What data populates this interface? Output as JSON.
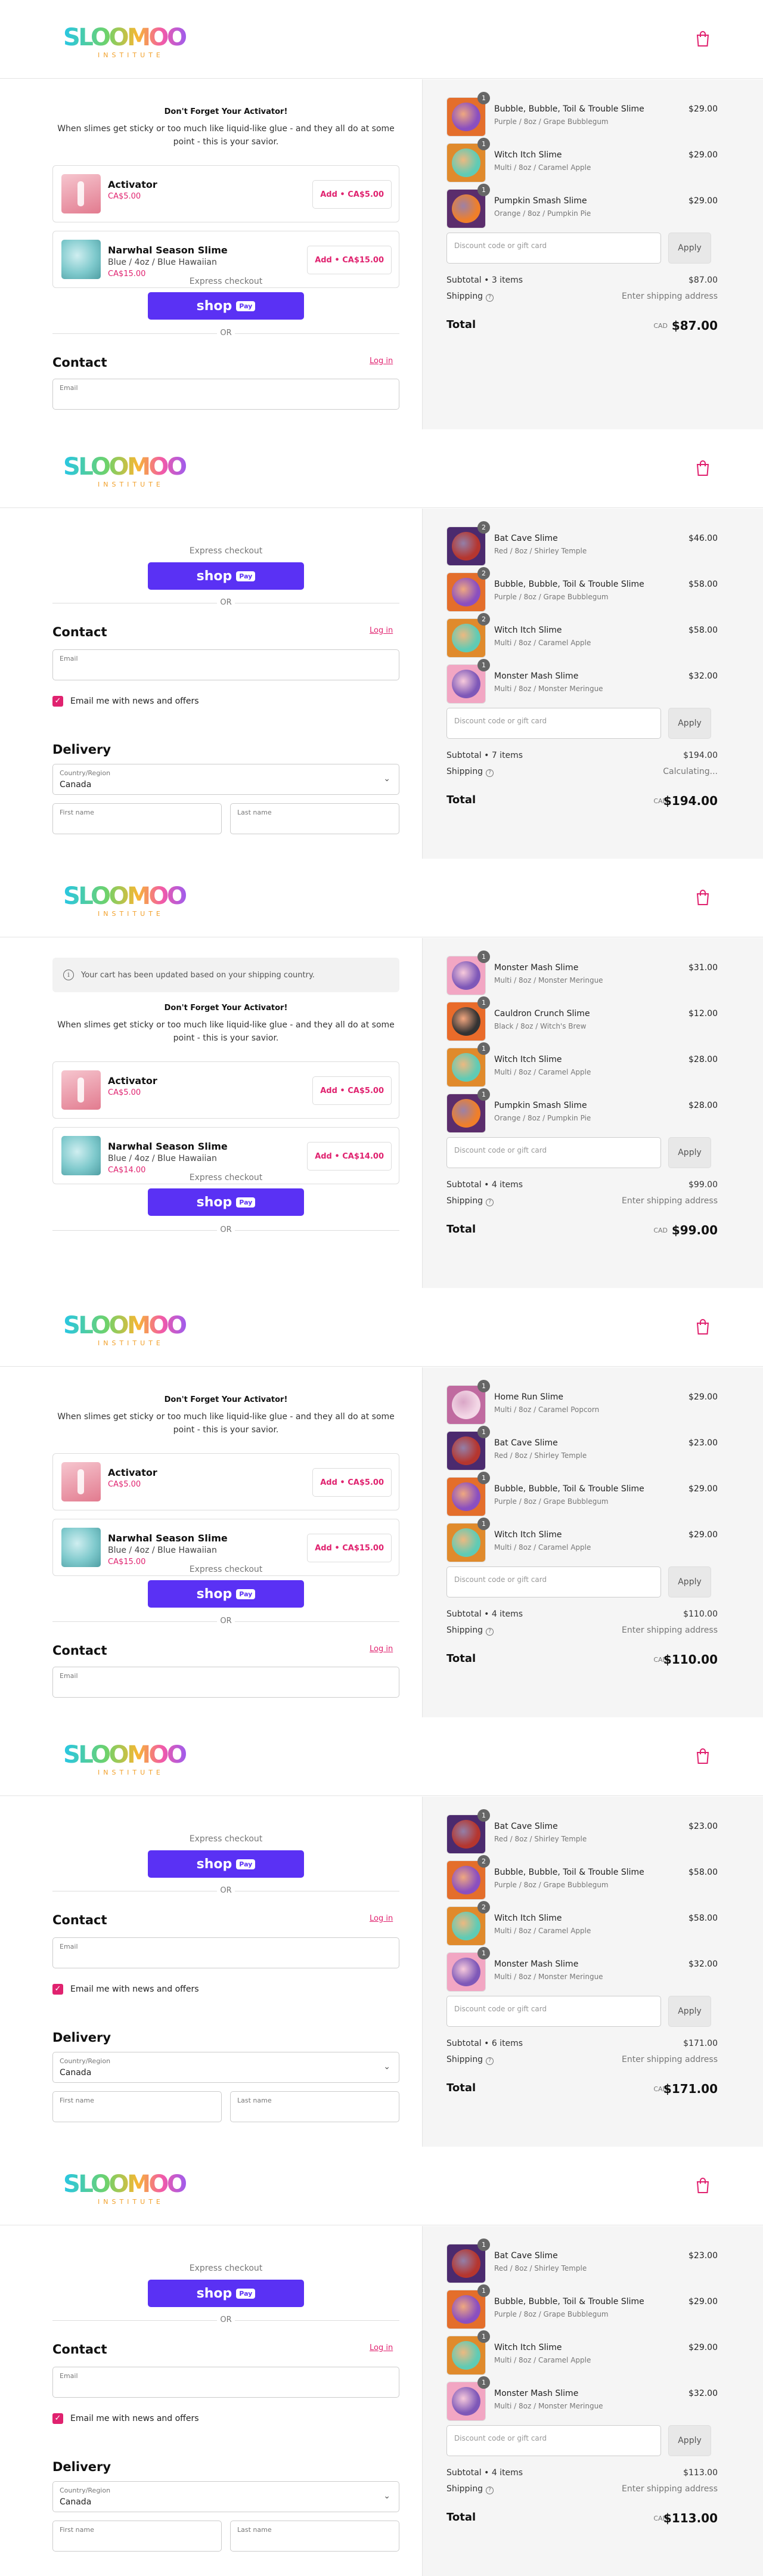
{
  "brand": {
    "name": "SLOOMOO",
    "sub": "INSTITUTE"
  },
  "common": {
    "upsell_title": "Don't Forget Your Activator!",
    "upsell_desc": "When slimes get sticky or too much like liquid-like glue - and they all do at some point - this is your savior.",
    "express_checkout": "Express checkout",
    "shop_label": "shop",
    "pay_label": "Pay",
    "or": "OR",
    "contact": "Contact",
    "login": "Log in",
    "email_label": "Email",
    "news_label": "Email me with news and offers",
    "delivery": "Delivery",
    "country_label": "Country/Region",
    "country_value": "Canada",
    "first_name": "First name",
    "last_name": "Last name",
    "discount_placeholder": "Discount code or gift card",
    "apply": "Apply",
    "shipping": "Shipping",
    "enter_shipping": "Enter shipping address",
    "calculating": "Calculating...",
    "total": "Total",
    "currency": "CAD",
    "cart_updated": "Your cart has been updated based on your shipping country."
  },
  "panels": [
    {
      "upsell": [
        {
          "name": "Activator",
          "variant": "",
          "price": "CA$5.00",
          "button": "Add • CA$5.00"
        },
        {
          "name": "Narwhal Season Slime",
          "variant": "Blue / 4oz / Blue Hawaiian",
          "price": "CA$15.00",
          "button": "Add • CA$15.00"
        }
      ],
      "items": [
        {
          "qty": "1",
          "name": "Bubble, Bubble, Toil & Trouble Slime",
          "variant": "Purple / 8oz / Grape Bubblegum",
          "price": "$29.00"
        },
        {
          "qty": "1",
          "name": "Witch Itch Slime",
          "variant": "Multi / 8oz / Caramel Apple",
          "price": "$29.00"
        },
        {
          "qty": "1",
          "name": "Pumpkin Smash Slime",
          "variant": "Orange / 8oz / Pumpkin Pie",
          "price": "$29.00"
        }
      ],
      "subtotal_label": "Subtotal • 3 items",
      "subtotal": "$87.00",
      "shipping_value": "Enter shipping address",
      "total": "$87.00"
    },
    {
      "items": [
        {
          "qty": "2",
          "name": "Bat Cave Slime",
          "variant": "Red / 8oz / Shirley Temple",
          "price": "$46.00"
        },
        {
          "qty": "2",
          "name": "Bubble, Bubble, Toil & Trouble Slime",
          "variant": "Purple / 8oz / Grape Bubblegum",
          "price": "$58.00"
        },
        {
          "qty": "2",
          "name": "Witch Itch Slime",
          "variant": "Multi / 8oz / Caramel Apple",
          "price": "$58.00"
        },
        {
          "qty": "1",
          "name": "Monster Mash Slime",
          "variant": "Multi / 8oz / Monster Meringue",
          "price": "$32.00"
        }
      ],
      "subtotal_label": "Subtotal • 7 items",
      "subtotal": "$194.00",
      "shipping_value": "Calculating...",
      "total": "$194.00"
    },
    {
      "upsell": [
        {
          "name": "Activator",
          "variant": "",
          "price": "CA$5.00",
          "button": "Add • CA$5.00"
        },
        {
          "name": "Narwhal Season Slime",
          "variant": "Blue / 4oz / Blue Hawaiian",
          "price": "CA$14.00",
          "button": "Add • CA$14.00"
        }
      ],
      "items": [
        {
          "qty": "1",
          "name": "Monster Mash Slime",
          "variant": "Multi / 8oz / Monster Meringue",
          "price": "$31.00"
        },
        {
          "qty": "1",
          "name": "Cauldron Crunch Slime",
          "variant": "Black / 8oz / Witch's Brew",
          "price": "$12.00"
        },
        {
          "qty": "1",
          "name": "Witch Itch Slime",
          "variant": "Multi / 8oz / Caramel Apple",
          "price": "$28.00"
        },
        {
          "qty": "1",
          "name": "Pumpkin Smash Slime",
          "variant": "Orange / 8oz / Pumpkin Pie",
          "price": "$28.00"
        }
      ],
      "subtotal_label": "Subtotal • 4 items",
      "subtotal": "$99.00",
      "shipping_value": "Enter shipping address",
      "total": "$99.00"
    },
    {
      "upsell": [
        {
          "name": "Activator",
          "variant": "",
          "price": "CA$5.00",
          "button": "Add • CA$5.00"
        },
        {
          "name": "Narwhal Season Slime",
          "variant": "Blue / 4oz / Blue Hawaiian",
          "price": "CA$15.00",
          "button": "Add • CA$15.00"
        }
      ],
      "items": [
        {
          "qty": "1",
          "name": "Home Run Slime",
          "variant": "Multi / 8oz / Caramel Popcorn",
          "price": "$29.00"
        },
        {
          "qty": "1",
          "name": "Bat Cave Slime",
          "variant": "Red / 8oz / Shirley Temple",
          "price": "$23.00"
        },
        {
          "qty": "1",
          "name": "Bubble, Bubble, Toil & Trouble Slime",
          "variant": "Purple / 8oz / Grape Bubblegum",
          "price": "$29.00"
        },
        {
          "qty": "1",
          "name": "Witch Itch Slime",
          "variant": "Multi / 8oz / Caramel Apple",
          "price": "$29.00"
        }
      ],
      "subtotal_label": "Subtotal • 4 items",
      "subtotal": "$110.00",
      "shipping_value": "Enter shipping address",
      "total": "$110.00"
    },
    {
      "items": [
        {
          "qty": "1",
          "name": "Bat Cave Slime",
          "variant": "Red / 8oz / Shirley Temple",
          "price": "$23.00"
        },
        {
          "qty": "2",
          "name": "Bubble, Bubble, Toil & Trouble Slime",
          "variant": "Purple / 8oz / Grape Bubblegum",
          "price": "$58.00"
        },
        {
          "qty": "2",
          "name": "Witch Itch Slime",
          "variant": "Multi / 8oz / Caramel Apple",
          "price": "$58.00"
        },
        {
          "qty": "1",
          "name": "Monster Mash Slime",
          "variant": "Multi / 8oz / Monster Meringue",
          "price": "$32.00"
        }
      ],
      "subtotal_label": "Subtotal • 6 items",
      "subtotal": "$171.00",
      "shipping_value": "Enter shipping address",
      "total": "$171.00"
    },
    {
      "items": [
        {
          "qty": "1",
          "name": "Bat Cave Slime",
          "variant": "Red / 8oz / Shirley Temple",
          "price": "$23.00"
        },
        {
          "qty": "1",
          "name": "Bubble, Bubble, Toil & Trouble Slime",
          "variant": "Purple / 8oz / Grape Bubblegum",
          "price": "$29.00"
        },
        {
          "qty": "1",
          "name": "Witch Itch Slime",
          "variant": "Multi / 8oz / Caramel Apple",
          "price": "$29.00"
        },
        {
          "qty": "1",
          "name": "Monster Mash Slime",
          "variant": "Multi / 8oz / Monster Meringue",
          "price": "$32.00"
        }
      ],
      "subtotal_label": "Subtotal • 4 items",
      "subtotal": "$113.00",
      "shipping_value": "Enter shipping address",
      "total": "$113.00"
    }
  ],
  "colors": {
    "accent": "#e0226f",
    "shop_pay": "#5a31f4",
    "summary_bg": "#f5f5f5"
  }
}
